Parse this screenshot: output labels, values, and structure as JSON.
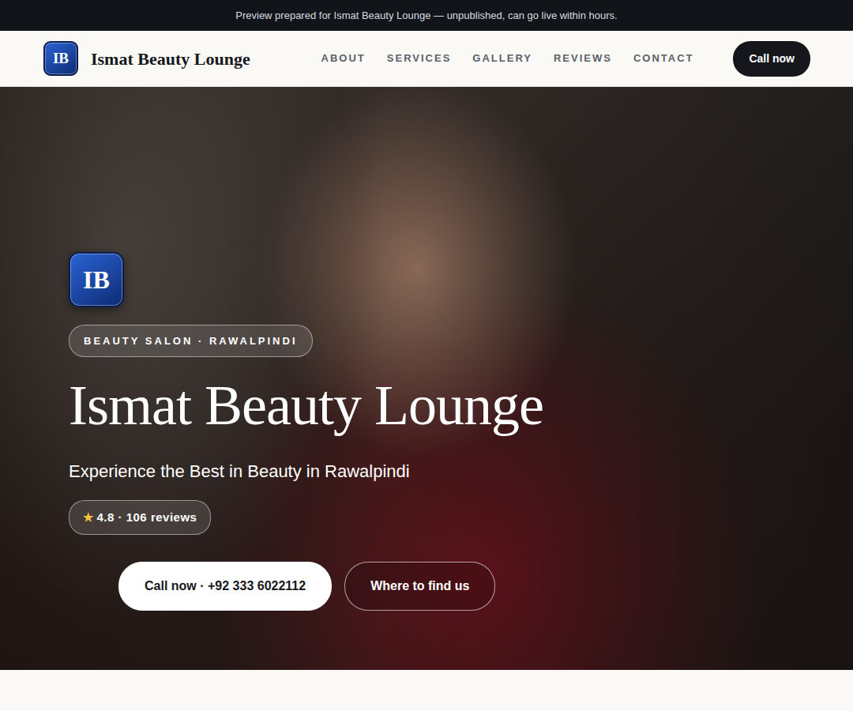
{
  "banner": {
    "text": "Preview prepared for Ismat Beauty Lounge — unpublished, can go live within hours."
  },
  "nav": {
    "logo": "IB",
    "brand": "Ismat Beauty Lounge",
    "links": [
      "ABOUT",
      "SERVICES",
      "GALLERY",
      "REVIEWS",
      "CONTACT"
    ],
    "cta": "Call now"
  },
  "hero": {
    "logo": "IB",
    "tag": "BEAUTY SALON · RAWALPINDI",
    "title": "Ismat Beauty Lounge",
    "subtitle": "Experience the Best in Beauty in Rawalpindi",
    "rating": {
      "icon": "★",
      "text": "4.8 · 106 reviews"
    },
    "buttons": [
      {
        "label": "Call now · +92 333 6022112",
        "kind": "primary"
      },
      {
        "label": "Where to find us",
        "kind": "outline"
      }
    ]
  }
}
